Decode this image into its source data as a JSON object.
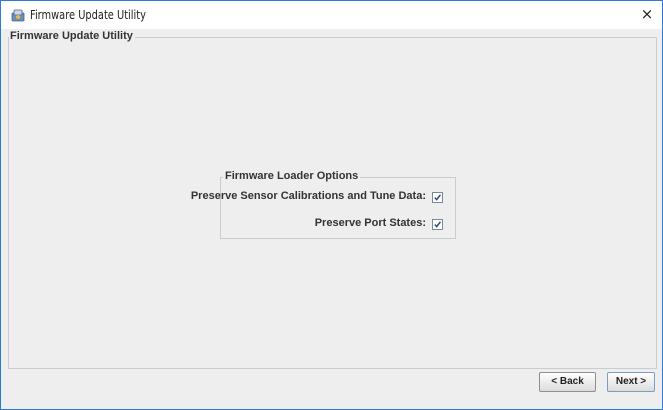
{
  "window": {
    "title": "Firmware Update Utility",
    "close_symbol": "×",
    "icon": "app-icon"
  },
  "main_group": {
    "legend": "Firmware Update Utility"
  },
  "loader_options": {
    "legend": "Firmware Loader Options",
    "options": [
      {
        "label": "Preserve Sensor Calibrations and Tune Data:",
        "checked": true
      },
      {
        "label": "Preserve Port States:",
        "checked": true
      }
    ]
  },
  "navigation": {
    "back_label": "< Back",
    "next_label": "Next >"
  },
  "colors": {
    "window_border": "#2b7bd6",
    "panel_background": "#eeeeee",
    "check_mark": "#2c4a7a"
  }
}
